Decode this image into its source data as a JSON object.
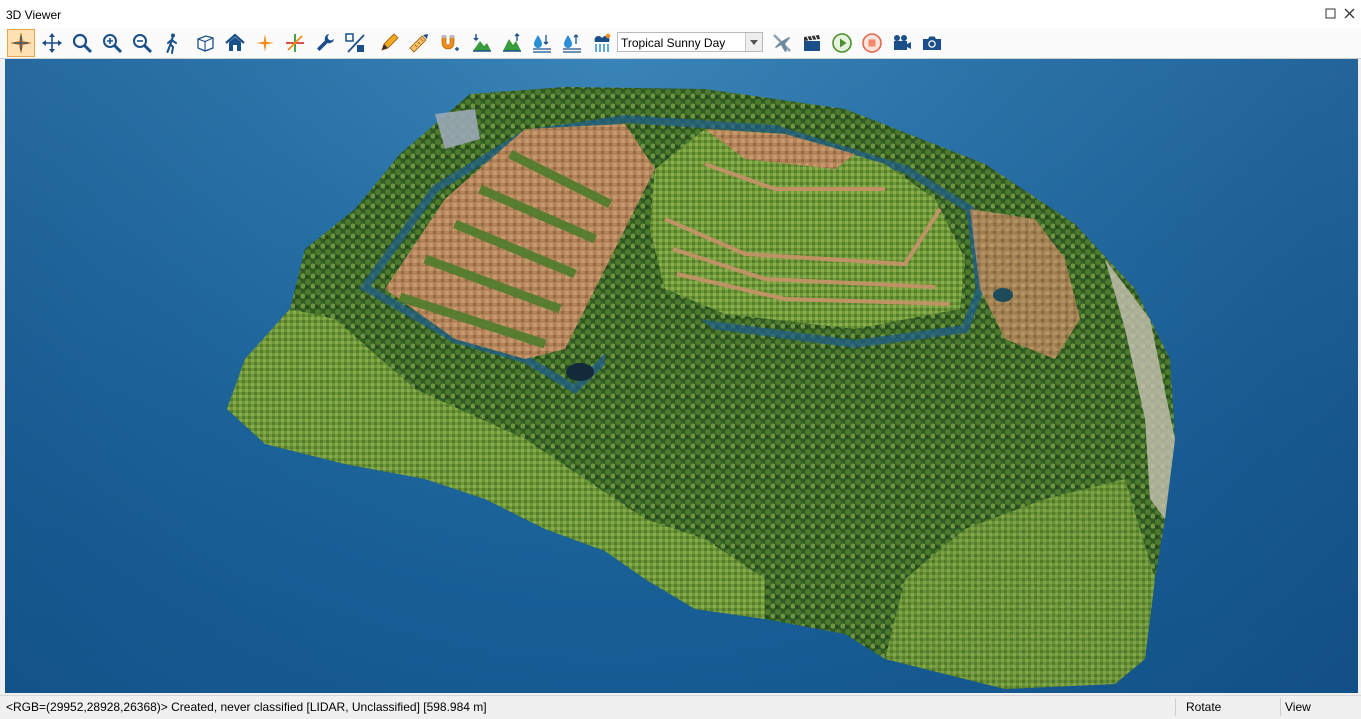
{
  "window": {
    "title": "3D Viewer"
  },
  "toolbar": {
    "tools": [
      {
        "name": "select-pan-tool-button",
        "icon": "crosshair-star-icon",
        "active": true
      },
      {
        "name": "move-tool-button",
        "icon": "move-arrows-icon"
      },
      {
        "name": "zoom-tool-button",
        "icon": "magnifier-icon"
      },
      {
        "name": "zoom-in-button",
        "icon": "zoom-in-icon"
      },
      {
        "name": "zoom-out-button",
        "icon": "zoom-out-icon"
      },
      {
        "name": "walk-tool-button",
        "icon": "walking-person-icon"
      },
      {
        "name": "bounding-box-button",
        "icon": "cube-icon"
      },
      {
        "name": "home-view-button",
        "icon": "home-icon"
      },
      {
        "name": "center-point-button",
        "icon": "orange-star-icon"
      },
      {
        "name": "axes-button",
        "icon": "axes-icon"
      },
      {
        "name": "settings-button",
        "icon": "wrench-icon"
      },
      {
        "name": "ratio-button",
        "icon": "percent-icon"
      },
      {
        "name": "edit-button",
        "icon": "pencil-icon"
      },
      {
        "name": "measure-button",
        "icon": "ruler-pencil-icon"
      },
      {
        "name": "snap-button",
        "icon": "magnet-icon"
      },
      {
        "name": "terrain-down-button",
        "icon": "terrain-down-icon"
      },
      {
        "name": "terrain-up-button",
        "icon": "terrain-up-icon"
      },
      {
        "name": "water-level-down-button",
        "icon": "water-down-icon"
      },
      {
        "name": "water-level-up-button",
        "icon": "water-up-icon"
      },
      {
        "name": "atmosphere-button",
        "icon": "atmosphere-icon"
      }
    ],
    "sky_preset": {
      "value": "Tropical Sunny Day"
    },
    "tools2": [
      {
        "name": "fly-button",
        "icon": "airplane-icon"
      },
      {
        "name": "clapper-button",
        "icon": "clapperboard-icon"
      },
      {
        "name": "play-button",
        "icon": "play-icon"
      },
      {
        "name": "stop-button",
        "icon": "stop-icon"
      },
      {
        "name": "record-button",
        "icon": "video-camera-icon"
      },
      {
        "name": "screenshot-button",
        "icon": "camera-icon"
      }
    ]
  },
  "status": {
    "info": "<RGB=(29952,28928,26368)> Created, never classified [LIDAR, Unclassified] [598.984 m]",
    "mode": "Rotate",
    "view": "View"
  },
  "colors": {
    "water": "#1a639b",
    "accent": "#e8a64a"
  }
}
